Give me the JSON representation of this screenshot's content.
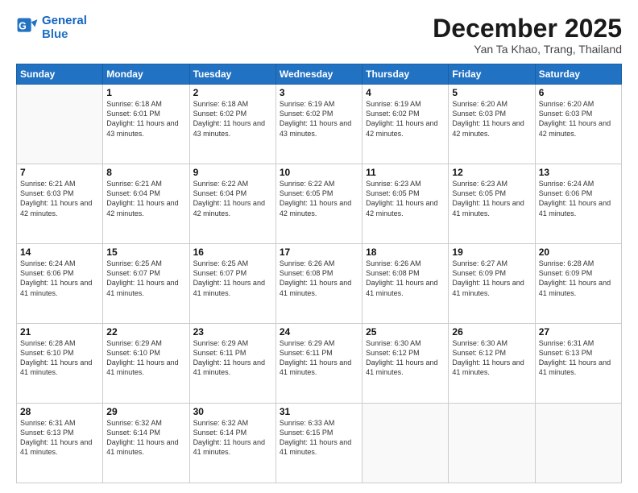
{
  "header": {
    "logo_line1": "General",
    "logo_line2": "Blue",
    "month": "December 2025",
    "location": "Yan Ta Khao, Trang, Thailand"
  },
  "days_of_week": [
    "Sunday",
    "Monday",
    "Tuesday",
    "Wednesday",
    "Thursday",
    "Friday",
    "Saturday"
  ],
  "weeks": [
    [
      {
        "day": null
      },
      {
        "day": "1",
        "sunrise": "6:18 AM",
        "sunset": "6:01 PM",
        "daylight": "11 hours and 43 minutes."
      },
      {
        "day": "2",
        "sunrise": "6:18 AM",
        "sunset": "6:02 PM",
        "daylight": "11 hours and 43 minutes."
      },
      {
        "day": "3",
        "sunrise": "6:19 AM",
        "sunset": "6:02 PM",
        "daylight": "11 hours and 43 minutes."
      },
      {
        "day": "4",
        "sunrise": "6:19 AM",
        "sunset": "6:02 PM",
        "daylight": "11 hours and 42 minutes."
      },
      {
        "day": "5",
        "sunrise": "6:20 AM",
        "sunset": "6:03 PM",
        "daylight": "11 hours and 42 minutes."
      },
      {
        "day": "6",
        "sunrise": "6:20 AM",
        "sunset": "6:03 PM",
        "daylight": "11 hours and 42 minutes."
      }
    ],
    [
      {
        "day": "7",
        "sunrise": "6:21 AM",
        "sunset": "6:03 PM",
        "daylight": "11 hours and 42 minutes."
      },
      {
        "day": "8",
        "sunrise": "6:21 AM",
        "sunset": "6:04 PM",
        "daylight": "11 hours and 42 minutes."
      },
      {
        "day": "9",
        "sunrise": "6:22 AM",
        "sunset": "6:04 PM",
        "daylight": "11 hours and 42 minutes."
      },
      {
        "day": "10",
        "sunrise": "6:22 AM",
        "sunset": "6:05 PM",
        "daylight": "11 hours and 42 minutes."
      },
      {
        "day": "11",
        "sunrise": "6:23 AM",
        "sunset": "6:05 PM",
        "daylight": "11 hours and 42 minutes."
      },
      {
        "day": "12",
        "sunrise": "6:23 AM",
        "sunset": "6:05 PM",
        "daylight": "11 hours and 41 minutes."
      },
      {
        "day": "13",
        "sunrise": "6:24 AM",
        "sunset": "6:06 PM",
        "daylight": "11 hours and 41 minutes."
      }
    ],
    [
      {
        "day": "14",
        "sunrise": "6:24 AM",
        "sunset": "6:06 PM",
        "daylight": "11 hours and 41 minutes."
      },
      {
        "day": "15",
        "sunrise": "6:25 AM",
        "sunset": "6:07 PM",
        "daylight": "11 hours and 41 minutes."
      },
      {
        "day": "16",
        "sunrise": "6:25 AM",
        "sunset": "6:07 PM",
        "daylight": "11 hours and 41 minutes."
      },
      {
        "day": "17",
        "sunrise": "6:26 AM",
        "sunset": "6:08 PM",
        "daylight": "11 hours and 41 minutes."
      },
      {
        "day": "18",
        "sunrise": "6:26 AM",
        "sunset": "6:08 PM",
        "daylight": "11 hours and 41 minutes."
      },
      {
        "day": "19",
        "sunrise": "6:27 AM",
        "sunset": "6:09 PM",
        "daylight": "11 hours and 41 minutes."
      },
      {
        "day": "20",
        "sunrise": "6:28 AM",
        "sunset": "6:09 PM",
        "daylight": "11 hours and 41 minutes."
      }
    ],
    [
      {
        "day": "21",
        "sunrise": "6:28 AM",
        "sunset": "6:10 PM",
        "daylight": "11 hours and 41 minutes."
      },
      {
        "day": "22",
        "sunrise": "6:29 AM",
        "sunset": "6:10 PM",
        "daylight": "11 hours and 41 minutes."
      },
      {
        "day": "23",
        "sunrise": "6:29 AM",
        "sunset": "6:11 PM",
        "daylight": "11 hours and 41 minutes."
      },
      {
        "day": "24",
        "sunrise": "6:29 AM",
        "sunset": "6:11 PM",
        "daylight": "11 hours and 41 minutes."
      },
      {
        "day": "25",
        "sunrise": "6:30 AM",
        "sunset": "6:12 PM",
        "daylight": "11 hours and 41 minutes."
      },
      {
        "day": "26",
        "sunrise": "6:30 AM",
        "sunset": "6:12 PM",
        "daylight": "11 hours and 41 minutes."
      },
      {
        "day": "27",
        "sunrise": "6:31 AM",
        "sunset": "6:13 PM",
        "daylight": "11 hours and 41 minutes."
      }
    ],
    [
      {
        "day": "28",
        "sunrise": "6:31 AM",
        "sunset": "6:13 PM",
        "daylight": "11 hours and 41 minutes."
      },
      {
        "day": "29",
        "sunrise": "6:32 AM",
        "sunset": "6:14 PM",
        "daylight": "11 hours and 41 minutes."
      },
      {
        "day": "30",
        "sunrise": "6:32 AM",
        "sunset": "6:14 PM",
        "daylight": "11 hours and 41 minutes."
      },
      {
        "day": "31",
        "sunrise": "6:33 AM",
        "sunset": "6:15 PM",
        "daylight": "11 hours and 41 minutes."
      },
      {
        "day": null
      },
      {
        "day": null
      },
      {
        "day": null
      }
    ]
  ]
}
